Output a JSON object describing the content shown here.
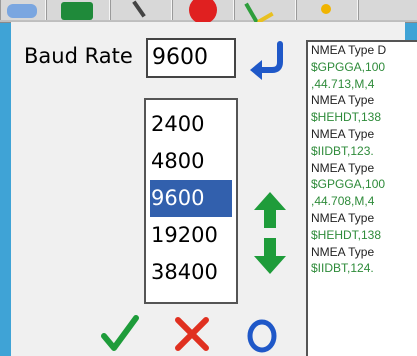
{
  "colors": {
    "frame": "#3fa3d6",
    "panel": "#f0f0f0",
    "selection": "#3260ad",
    "log_header": "#222222",
    "log_data": "#2e8b3a",
    "arrow_green": "#1e9c3a",
    "cancel_red": "#e03020",
    "reset_blue": "#1f58c8"
  },
  "toolbar": {
    "buttons": [
      "blue-tool-icon",
      "green-tool-icon",
      "edit-tool-icon",
      "red-circle-icon",
      "green-check-tool-icon",
      "yellow-tool-icon"
    ]
  },
  "settings": {
    "baud_label": "Baud Rate",
    "baud_value": "9600",
    "enter_icon": "enter-return-icon"
  },
  "baud_list": {
    "options": [
      "2400",
      "4800",
      "9600",
      "19200",
      "38400"
    ],
    "selected": "9600"
  },
  "controls": {
    "up_icon": "arrow-up-icon",
    "down_icon": "arrow-down-icon",
    "ok_icon": "checkmark-icon",
    "cancel_icon": "x-cancel-icon",
    "reset_icon": "circle-icon"
  },
  "log": {
    "lines": [
      {
        "text": "NMEA Type D",
        "kind": "hdr"
      },
      {
        "text": "$GPGGA,100",
        "kind": "dat"
      },
      {
        "text": ",44.713,M,4",
        "kind": "dat"
      },
      {
        "text": "NMEA Type",
        "kind": "hdr"
      },
      {
        "text": "$HEHDT,138",
        "kind": "dat"
      },
      {
        "text": "NMEA Type",
        "kind": "hdr"
      },
      {
        "text": "$IIDBT,123.",
        "kind": "dat"
      },
      {
        "text": "NMEA Type",
        "kind": "hdr"
      },
      {
        "text": "$GPGGA,100",
        "kind": "dat"
      },
      {
        "text": ",44.708,M,4",
        "kind": "dat"
      },
      {
        "text": "NMEA Type",
        "kind": "hdr"
      },
      {
        "text": "$HEHDT,138",
        "kind": "dat"
      },
      {
        "text": "NMEA Type",
        "kind": "hdr"
      },
      {
        "text": "$IIDBT,124.",
        "kind": "dat"
      }
    ]
  }
}
